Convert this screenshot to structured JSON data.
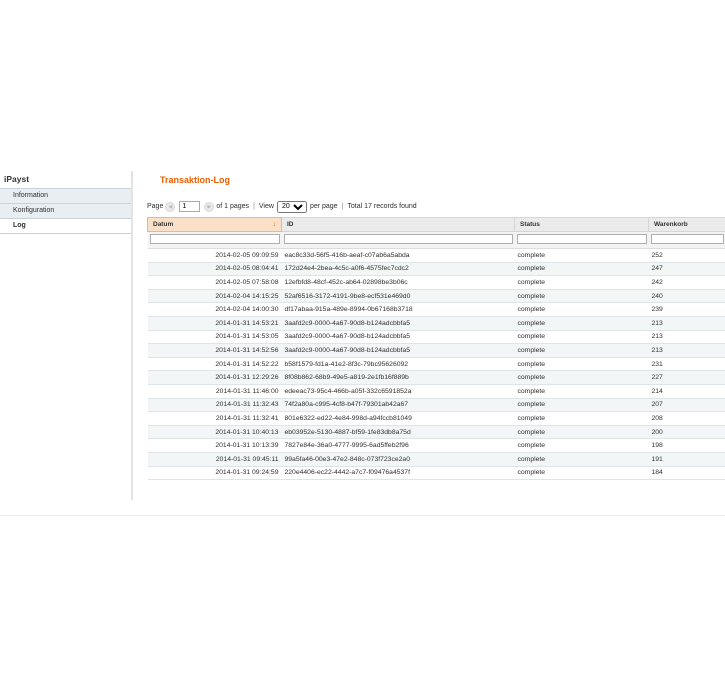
{
  "sidebar": {
    "title": "iPayst",
    "items": [
      {
        "label": "Information"
      },
      {
        "label": "Konfiguration"
      },
      {
        "label": "Log"
      }
    ]
  },
  "content": {
    "title": "Transaktion-Log"
  },
  "pager": {
    "page_label": "Page",
    "page_value": "1",
    "of_pages": "of 1 pages",
    "view_label": "View",
    "view_value": "20",
    "per_page": "per page",
    "total": "Total 17 records found"
  },
  "grid": {
    "columns": [
      "Datum",
      "ID",
      "Status",
      "Warenkorb"
    ],
    "sorted_column": "Datum",
    "rows": [
      [
        "2014-02-05 09:09:59",
        "eac8c33d-56f5-416b-aeaf-c07ab6a5abda",
        "complete",
        "252"
      ],
      [
        "2014-02-05 08:04:41",
        "172d24e4-2bea-4c5c-a0f6-4575fec7cdc2",
        "complete",
        "247"
      ],
      [
        "2014-02-05 07:58:08",
        "12efbfd8-48cf-452c-ab64-02898be3b06c",
        "complete",
        "242"
      ],
      [
        "2014-02-04 14:15:25",
        "52af6516-3172-4191-9be8-ecf531e469d0",
        "complete",
        "240"
      ],
      [
        "2014-02-04 14:00:30",
        "df17abaa-915a-489e-8994-0b67168b3718",
        "complete",
        "239"
      ],
      [
        "2014-01-31 14:53:21",
        "3aafd2c9-0000-4a67-90d8-b124adcbbfa5",
        "complete",
        "213"
      ],
      [
        "2014-01-31 14:53:05",
        "3aafd2c9-0000-4a67-90d8-b124adcbbfa5",
        "complete",
        "213"
      ],
      [
        "2014-01-31 14:52:56",
        "3aafd2c9-0000-4a67-90d8-b124adcbbfa5",
        "complete",
        "213"
      ],
      [
        "2014-01-31 14:52:22",
        "b58f1579-fd1a-41e2-8f3c-79bc95626092",
        "complete",
        "231"
      ],
      [
        "2014-01-31 12:29:26",
        "8f08b862-68b9-49e5-a819-2e1fb16f889b",
        "complete",
        "227"
      ],
      [
        "2014-01-31 11:46:00",
        "edeeac73-95c4-466b-a05f-332c6591852a",
        "complete",
        "214"
      ],
      [
        "2014-01-31 11:32:43",
        "74f2a80a-c995-4cf8-b47f-79301ab42a67",
        "complete",
        "207"
      ],
      [
        "2014-01-31 11:32:41",
        "801e6322-ed22-4e84-998d-a94fccb81049",
        "complete",
        "208"
      ],
      [
        "2014-01-31 10:40:13",
        "eb03952e-5130-4887-bf59-1fe83db8a75d",
        "complete",
        "200"
      ],
      [
        "2014-01-31 10:13:39",
        "7827e84e-36a0-4777-9995-6ad5ffeb2f96",
        "complete",
        "198"
      ],
      [
        "2014-01-31 09:45:11",
        "99a5fa46-00e3-47e2-848c-073f723ce2a0",
        "complete",
        "191"
      ],
      [
        "2014-01-31 09:24:59",
        "220e4406-ec22-4442-a7c7-f09476a4537f",
        "complete",
        "184"
      ]
    ]
  },
  "colors": {
    "title_orange": "#eb5e00",
    "sorted_header": "#fbe0c8",
    "sidebar_bg": "#e8eef1"
  }
}
